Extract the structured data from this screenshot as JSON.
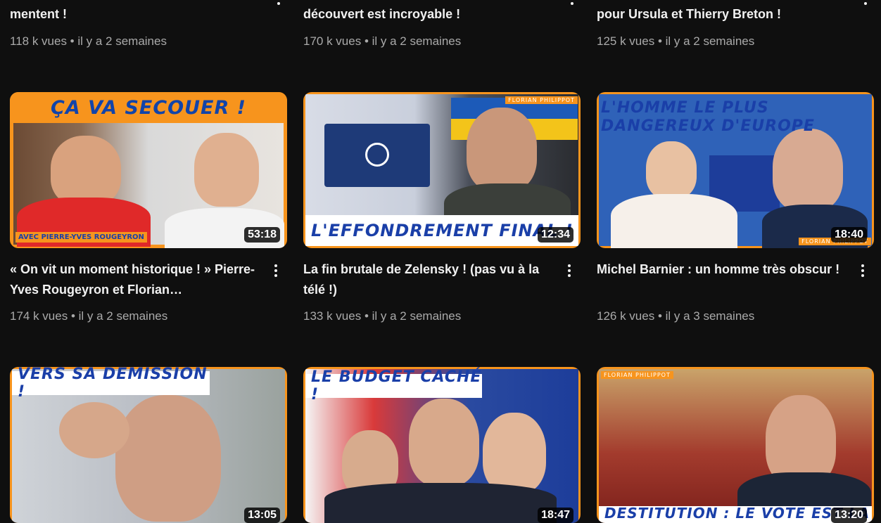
{
  "top_row": [
    {
      "title": "mentent !",
      "meta": "118 k vues • il y a 2 semaines"
    },
    {
      "title": "découvert est incroyable !",
      "meta": "170 k vues • il y a 2 semaines"
    },
    {
      "title": "pour Ursula et Thierry Breton !",
      "meta": "125 k vues • il y a 2 semaines"
    }
  ],
  "middle_row": [
    {
      "banner": "ÇA VA SECOUER !",
      "bottom_caption": "AVEC PIERRE-YVES ROUGEYRON",
      "duration": "53:18",
      "title": "« On vit un moment historique ! » Pierre-Yves Rougeyron et Florian…",
      "meta": "174 k vues • il y a 2 semaines"
    },
    {
      "banner": "",
      "brand": "FLORIAN PHILIPPOT",
      "bottom_caption": "L'EFFONDREMENT FINAL !",
      "duration": "12:34",
      "title": "La fin brutale de Zelensky ! (pas vu à la télé !)",
      "meta": "133 k vues • il y a 2 semaines"
    },
    {
      "banner": "L'HOMME LE PLUS DANGEREUX D'EUROPE",
      "brand": "FLORIAN PHILIPPOT",
      "duration": "18:40",
      "title": "Michel Barnier : un homme très obscur !",
      "meta": "126 k vues • il y a 3 semaines"
    }
  ],
  "bottom_row": [
    {
      "banner": "VERS SA DÉMISSION !",
      "duration": "13:05"
    },
    {
      "banner": "LE BUDGET CACHÉ !",
      "duration": "18:47"
    },
    {
      "brand": "FLORIAN PHILIPPOT",
      "bottom_caption": "DESTITUTION : LE VOTE EST LA !",
      "duration": "13:20"
    }
  ]
}
